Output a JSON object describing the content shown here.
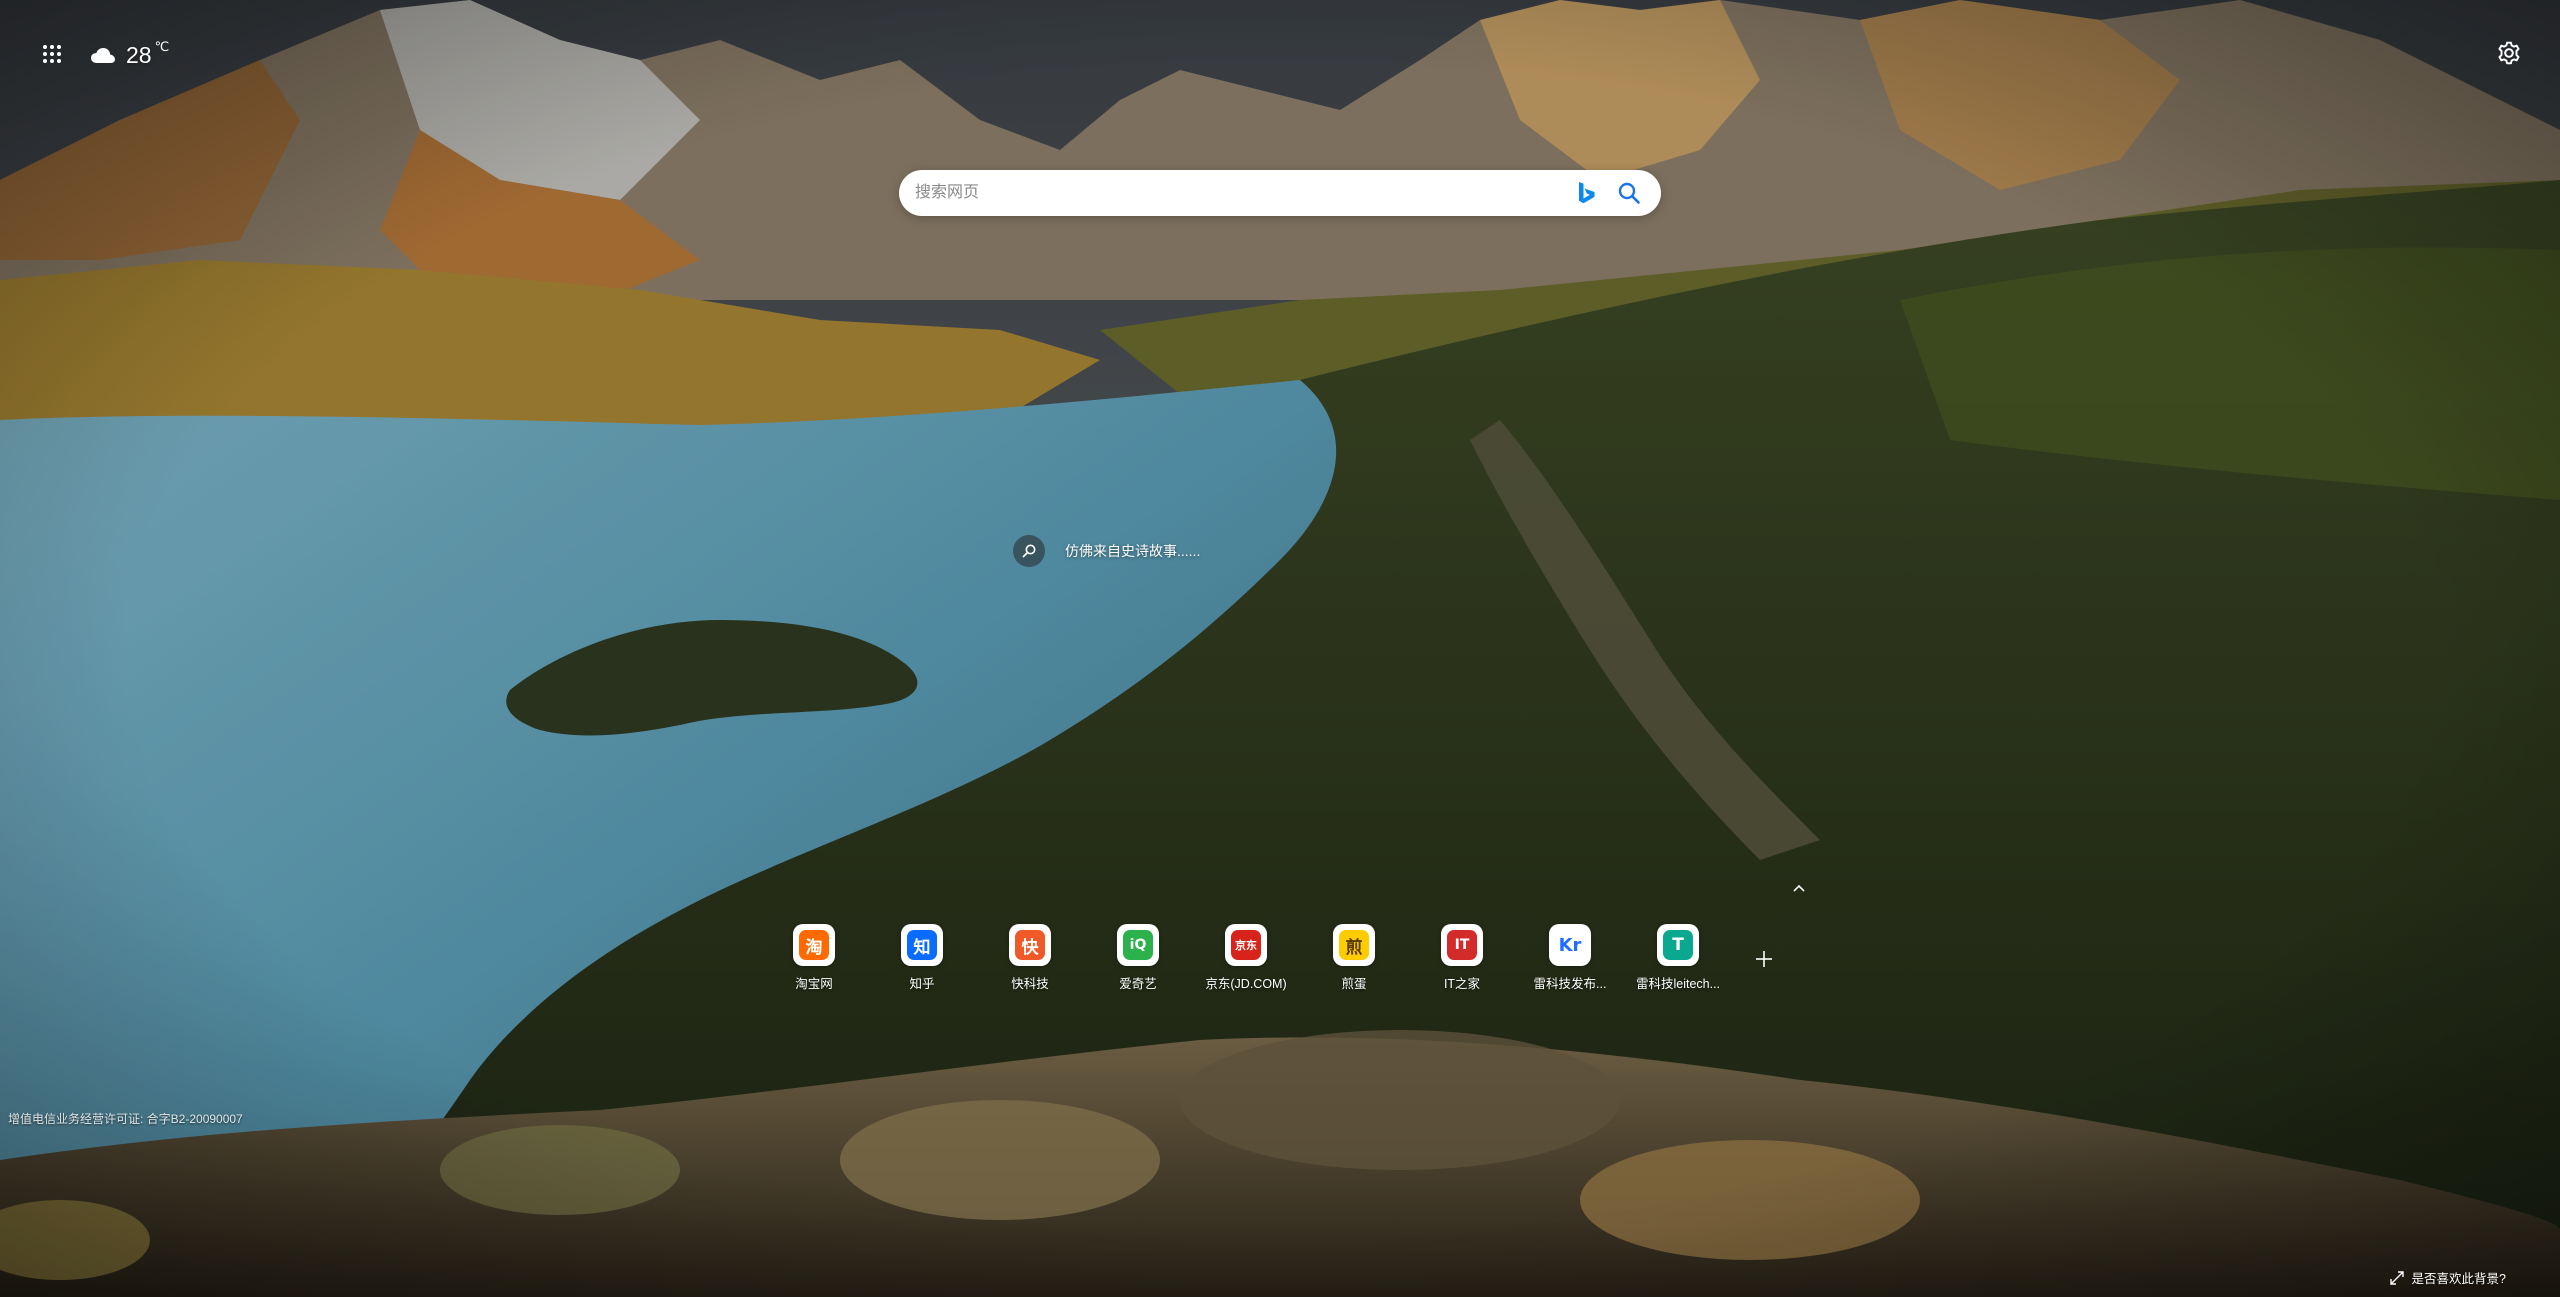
{
  "weather": {
    "temperature": "28",
    "unit": "℃",
    "icon": "cloud-icon"
  },
  "search": {
    "placeholder": "搜索网页",
    "engine_icon": "bing-logo-icon",
    "submit_icon": "search-icon"
  },
  "quote": {
    "text": "仿佛来自史诗故事......",
    "icon": "search-icon"
  },
  "shortcuts": [
    {
      "label": "淘宝网",
      "glyph": "淘",
      "color": "#ff5000",
      "glyph_bg": "#ff6a00"
    },
    {
      "label": "知乎",
      "glyph": "知",
      "color": "#0066ff",
      "glyph_bg": "#0a6cff"
    },
    {
      "label": "快科技",
      "glyph": "快",
      "color": "#ff4d1a",
      "glyph_bg": "#f05a28"
    },
    {
      "label": "爱奇艺",
      "glyph": "iQ",
      "color": "#00be06",
      "glyph_bg": "#2bb24c"
    },
    {
      "label": "京东(JD.COM)",
      "glyph": "京东",
      "color": "#e1251b",
      "glyph_bg": "#d8231b"
    },
    {
      "label": "煎蛋",
      "glyph": "煎",
      "color": "#ffd400",
      "glyph_bg": "#ffcc00"
    },
    {
      "label": "IT之家",
      "glyph": "IT",
      "color": "#d22222",
      "glyph_bg": "#d32a2a"
    },
    {
      "label": "雷科技发布...",
      "glyph": "Kr",
      "color": "#1e6fff",
      "glyph_bg": "#ffffff"
    },
    {
      "label": "雷科技leitech...",
      "glyph": "T",
      "color": "#00a58e",
      "glyph_bg": "#0aa98f"
    }
  ],
  "footer": {
    "license": "增值电信业务经营许可证: 合字B2-20090007",
    "feedback": "是否喜欢此背景?"
  },
  "colors": {
    "search_bar_bg": "#ffffff",
    "bing_blue": "#0c8aeb",
    "text_on_wallpaper": "#ffffff"
  }
}
